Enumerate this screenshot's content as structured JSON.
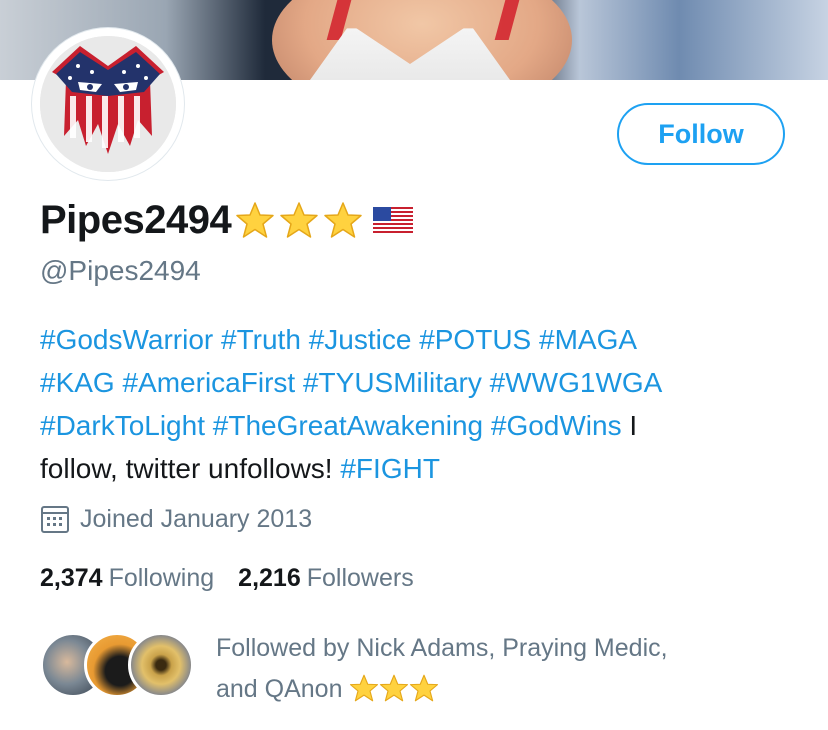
{
  "profile": {
    "display_name": "Pipes2494",
    "name_emojis": [
      "star-emoji",
      "star-emoji",
      "star-emoji",
      "us-flag-emoji"
    ],
    "handle": "@Pipes2494",
    "follow_label": "Follow",
    "bio": {
      "line1": [
        "#GodsWarrior",
        "#Truth",
        "#Justice",
        "#POTUS",
        "#MAGA"
      ],
      "line2": [
        "#KAG",
        "#AmericaFirst",
        "#TYUSMilitary",
        "#WWG1WGA"
      ],
      "line3_tags": [
        "#DarkToLight",
        "#TheGreatAwakening",
        "#GodWins"
      ],
      "line3_text": "I",
      "line4_text": "follow, twitter unfollows!",
      "line4_tag": "#FIGHT"
    },
    "joined": "Joined January 2013",
    "following_count": "2,374",
    "following_label": "Following",
    "followers_count": "2,216",
    "followers_label": "Followers",
    "followed_by_line1": "Followed by Nick Adams, Praying Medic,",
    "followed_by_line2": "and QAnon"
  },
  "colors": {
    "accent": "#1da1f2",
    "link": "#1b95e0",
    "muted": "#657786",
    "text": "#14171a"
  }
}
